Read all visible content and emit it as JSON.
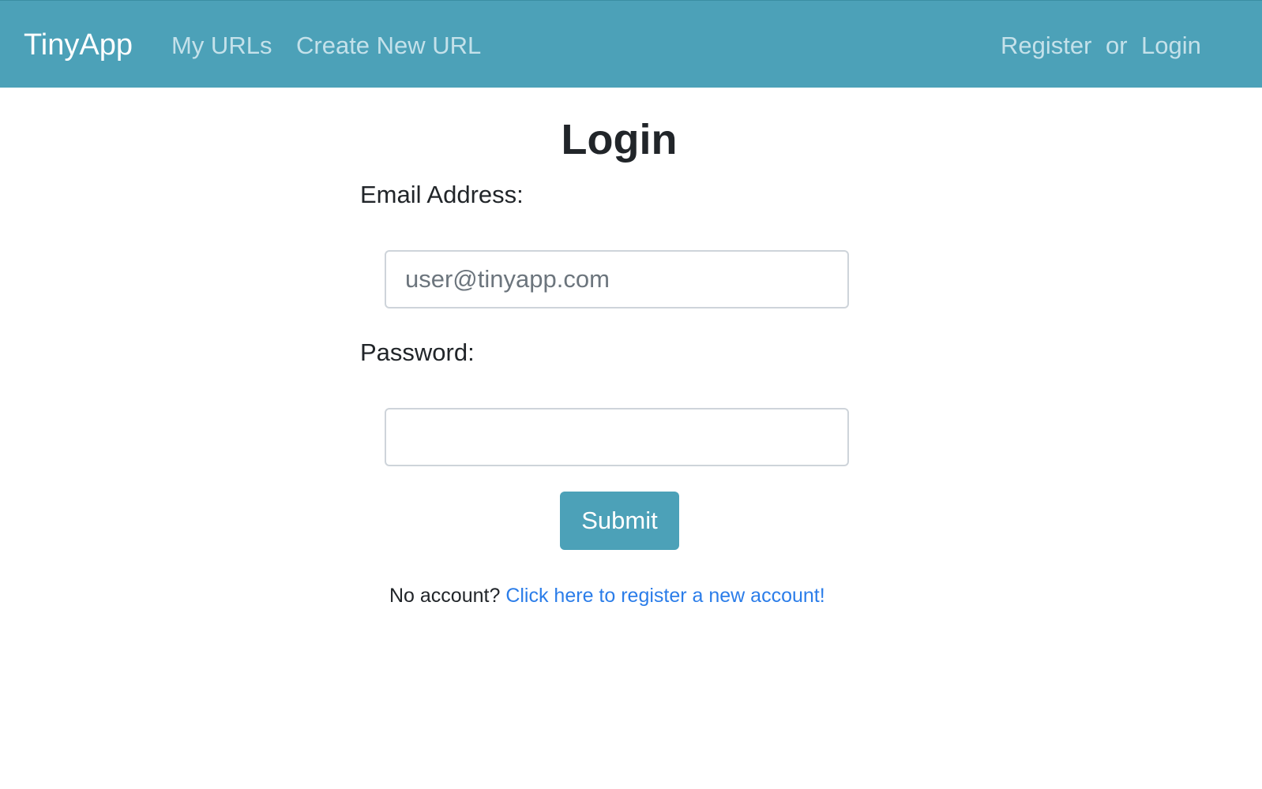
{
  "navbar": {
    "brand": "TinyApp",
    "links": {
      "my_urls": "My URLs",
      "create_new_url": "Create New URL",
      "register": "Register",
      "or": "or",
      "login": "Login"
    }
  },
  "form": {
    "title": "Login",
    "email_label": "Email Address:",
    "email_placeholder": "user@tinyapp.com",
    "email_value": "",
    "password_label": "Password:",
    "password_value": "",
    "submit_label": "Submit"
  },
  "footer": {
    "prompt": "No account?",
    "register_link": "Click here to register a new account!"
  },
  "colors": {
    "navbar_bg": "#4ca1b8",
    "button_bg": "#4ca1b8",
    "link": "#2b7de9"
  }
}
